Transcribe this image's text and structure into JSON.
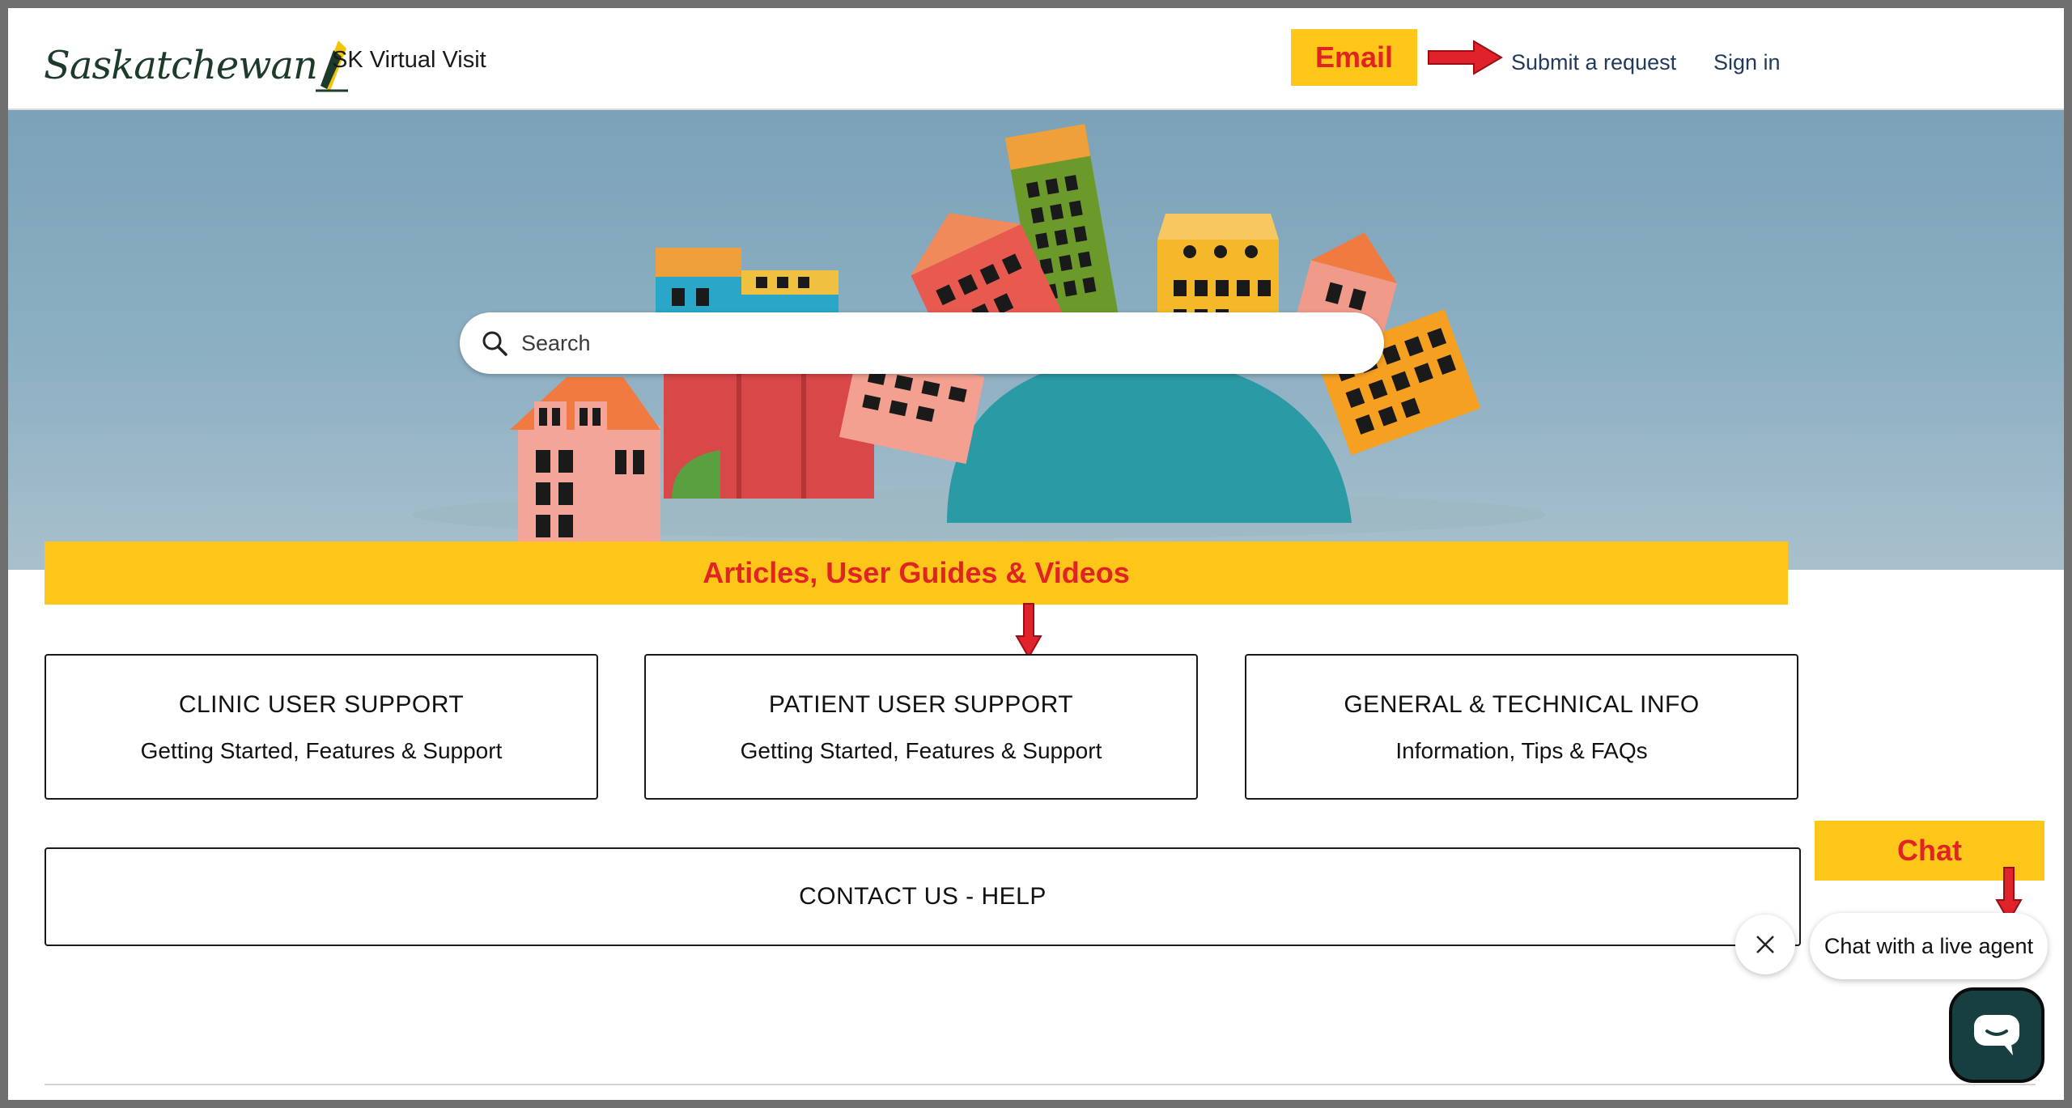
{
  "header": {
    "logo_text": "Saskatchewan",
    "site_name": "SK Virtual Visit",
    "nav": {
      "submit_request": "Submit a request",
      "sign_in": "Sign in"
    }
  },
  "annotations": {
    "email": "Email",
    "articles": "Articles, User Guides & Videos",
    "chat": "Chat"
  },
  "search": {
    "placeholder": "Search"
  },
  "cards": [
    {
      "title": "CLINIC USER SUPPORT",
      "subtitle": "Getting Started, Features & Support"
    },
    {
      "title": "PATIENT USER SUPPORT",
      "subtitle": "Getting Started, Features & Support"
    },
    {
      "title": "GENERAL & TECHNICAL INFO",
      "subtitle": "Information, Tips & FAQs"
    }
  ],
  "contact": {
    "label": "CONTACT US - HELP"
  },
  "chat": {
    "prompt": "Chat with a live agent"
  },
  "icons": [
    "search-icon",
    "close-icon",
    "chat-icon",
    "arrow-right-icon",
    "arrow-down-icon"
  ],
  "colors": {
    "annotation_bg": "#ffc61a",
    "annotation_text": "#e02424",
    "link": "#1f3a5a",
    "chat_button": "#173f3f"
  }
}
